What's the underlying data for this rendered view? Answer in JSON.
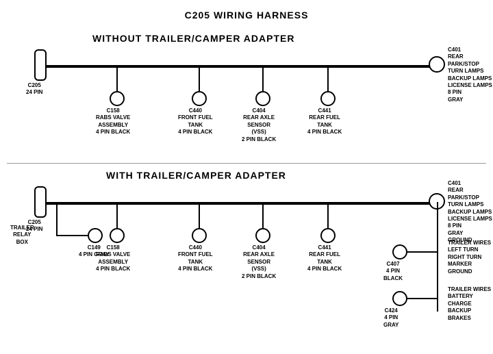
{
  "title": "C205 WIRING HARNESS",
  "section1": {
    "label": "WITHOUT  TRAILER/CAMPER ADAPTER",
    "connectors": [
      {
        "id": "C205_1",
        "label": "C205\n24 PIN"
      },
      {
        "id": "C158_1",
        "label": "C158\nRABS VALVE\nASSEMBLY\n4 PIN BLACK"
      },
      {
        "id": "C440_1",
        "label": "C440\nFRONT FUEL\nTANK\n4 PIN BLACK"
      },
      {
        "id": "C404_1",
        "label": "C404\nREAR AXLE\nSENSOR\n(VSS)\n2 PIN BLACK"
      },
      {
        "id": "C441_1",
        "label": "C441\nREAR FUEL\nTANK\n4 PIN BLACK"
      },
      {
        "id": "C401_1",
        "label": "C401\nREAR PARK/STOP\nTURN LAMPS\nBACKUP LAMPS\nLICENSE LAMPS\n8 PIN\nGRAY"
      }
    ]
  },
  "section2": {
    "label": "WITH TRAILER/CAMPER ADAPTER",
    "connectors": [
      {
        "id": "C205_2",
        "label": "C205\n24 PIN"
      },
      {
        "id": "C149",
        "label": "C149\n4 PIN GRAY"
      },
      {
        "id": "C158_2",
        "label": "C158\nRABS VALVE\nASSEMBLY\n4 PIN BLACK"
      },
      {
        "id": "C440_2",
        "label": "C440\nFRONT FUEL\nTANK\n4 PIN BLACK"
      },
      {
        "id": "C404_2",
        "label": "C404\nREAR AXLE\nSENSOR\n(VSS)\n2 PIN BLACK"
      },
      {
        "id": "C441_2",
        "label": "C441\nREAR FUEL\nTANK\n4 PIN BLACK"
      },
      {
        "id": "C401_2",
        "label": "C401\nREAR PARK/STOP\nTURN LAMPS\nBACKUP LAMPS\nLICENSE LAMPS\n8 PIN\nGRAY\nGROUND"
      },
      {
        "id": "C407",
        "label": "C407\n4 PIN\nBLACK"
      },
      {
        "id": "C424",
        "label": "C424\n4 PIN\nGRAY"
      },
      {
        "id": "trailer_relay",
        "label": "TRAILER\nRELAY\nBOX"
      },
      {
        "id": "trailer_wires_1",
        "label": "TRAILER WIRES\nLEFT TURN\nRIGHT TURN\nMARKER\nGROUND"
      },
      {
        "id": "trailer_wires_2",
        "label": "TRAILER WIRES\nBATTERY CHARGE\nBACKUP\nBRAKES"
      }
    ]
  }
}
